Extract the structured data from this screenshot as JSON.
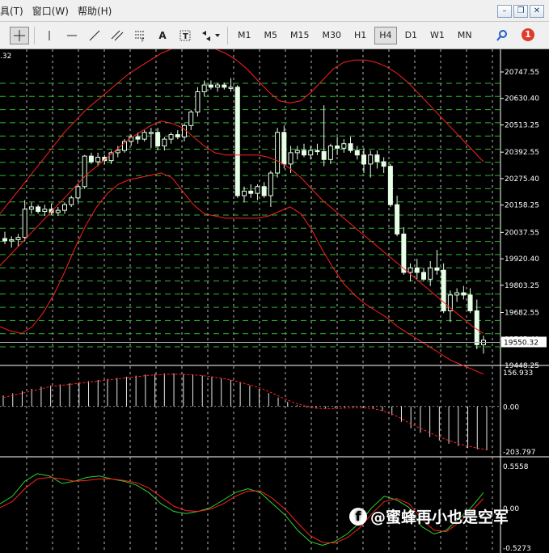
{
  "menu": {
    "items": [
      "具(T)",
      "窗口(W)",
      "帮助(H)"
    ]
  },
  "toolbar": {
    "tools": [
      "crosshair-icon",
      "vertical-line-icon",
      "horizontal-line-icon",
      "trend-line-icon",
      "channel-icon",
      "fibonacci-icon",
      "text-label-icon",
      "text-box-icon",
      "arrows-icon"
    ],
    "text_tool": "A",
    "timeframes": [
      "M1",
      "M5",
      "M15",
      "M30",
      "H1",
      "H4",
      "D1",
      "W1",
      "MN"
    ],
    "active_timeframe": "H4",
    "notification_count": "1"
  },
  "main_chart": {
    "top_left_label": ".32",
    "price_levels": [
      "20747.55",
      "20630.40",
      "20513.25",
      "20392.55",
      "20275.40",
      "20158.25",
      "20037.55",
      "19920.40",
      "19803.25",
      "19682.55",
      "19565.40",
      "19448.25"
    ],
    "current_price": "19550.32",
    "colors": {
      "background": "#000000",
      "grid": "#b8b8b8",
      "candle": "#e6ffe6",
      "bollinger": "#ff2020",
      "level_lines": "#2fb52f"
    }
  },
  "macd_panel": {
    "max_label": "156.933",
    "zero_label": "0.00",
    "min_label": "-203.797"
  },
  "stoch_panel": {
    "max_label": "0.5558",
    "zero_label": "0.00",
    "min_label": "-0.5273"
  },
  "chart_data": {
    "type": "candlestick",
    "price_range": [
      19448.25,
      20747.55
    ],
    "ohlc": [
      [
        20010,
        20040,
        19985,
        20000
      ],
      [
        20000,
        20020,
        19970,
        20005
      ],
      [
        20005,
        20030,
        19975,
        20015
      ],
      [
        20015,
        20180,
        20000,
        20140
      ],
      [
        20140,
        20170,
        20120,
        20150
      ],
      [
        20150,
        20160,
        20120,
        20130
      ],
      [
        20130,
        20160,
        20110,
        20140
      ],
      [
        20140,
        20165,
        20115,
        20125
      ],
      [
        20125,
        20150,
        20110,
        20135
      ],
      [
        20135,
        20170,
        20120,
        20160
      ],
      [
        20160,
        20200,
        20150,
        20190
      ],
      [
        20190,
        20250,
        20170,
        20240
      ],
      [
        20240,
        20380,
        20230,
        20375
      ],
      [
        20375,
        20390,
        20340,
        20350
      ],
      [
        20350,
        20390,
        20330,
        20370
      ],
      [
        20370,
        20380,
        20340,
        20355
      ],
      [
        20355,
        20400,
        20340,
        20390
      ],
      [
        20390,
        20420,
        20370,
        20400
      ],
      [
        20400,
        20450,
        20390,
        20440
      ],
      [
        20440,
        20470,
        20420,
        20460
      ],
      [
        20460,
        20480,
        20430,
        20450
      ],
      [
        20450,
        20490,
        20440,
        20480
      ],
      [
        20480,
        20500,
        20410,
        20480
      ],
      [
        20480,
        20500,
        20400,
        20420
      ],
      [
        20420,
        20460,
        20400,
        20450
      ],
      [
        20450,
        20480,
        20430,
        20470
      ],
      [
        20470,
        20490,
        20450,
        20460
      ],
      [
        20460,
        20520,
        20440,
        20510
      ],
      [
        20510,
        20580,
        20490,
        20570
      ],
      [
        20570,
        20680,
        20550,
        20660
      ],
      [
        20660,
        20710,
        20640,
        20690
      ],
      [
        20690,
        20710,
        20670,
        20680
      ],
      [
        20680,
        20700,
        20660,
        20690
      ],
      [
        20690,
        20700,
        20670,
        20680
      ],
      [
        20680,
        20720,
        20660,
        20680
      ],
      [
        20680,
        20690,
        20190,
        20200
      ],
      [
        20200,
        20240,
        20170,
        20220
      ],
      [
        20220,
        20250,
        20190,
        20210
      ],
      [
        20210,
        20250,
        20180,
        20240
      ],
      [
        20240,
        20260,
        20190,
        20200
      ],
      [
        20200,
        20310,
        20150,
        20300
      ],
      [
        20300,
        20500,
        20280,
        20480
      ],
      [
        20480,
        20510,
        20320,
        20340
      ],
      [
        20340,
        20420,
        20300,
        20390
      ],
      [
        20390,
        20420,
        20360,
        20400
      ],
      [
        20400,
        20430,
        20370,
        20380
      ],
      [
        20380,
        20420,
        20360,
        20400
      ],
      [
        20400,
        20430,
        20380,
        20395
      ],
      [
        20395,
        20600,
        20330,
        20360
      ],
      [
        20360,
        20430,
        20340,
        20420
      ],
      [
        20420,
        20460,
        20380,
        20410
      ],
      [
        20410,
        20450,
        20390,
        20430
      ],
      [
        20430,
        20460,
        20390,
        20400
      ],
      [
        20400,
        20420,
        20360,
        20380
      ],
      [
        20380,
        20410,
        20300,
        20340
      ],
      [
        20340,
        20400,
        20280,
        20380
      ],
      [
        20380,
        20400,
        20320,
        20350
      ],
      [
        20350,
        20370,
        20300,
        20330
      ],
      [
        20330,
        20340,
        20150,
        20160
      ],
      [
        20160,
        20200,
        20020,
        20030
      ],
      [
        20030,
        20060,
        19850,
        19860
      ],
      [
        19860,
        19900,
        19820,
        19880
      ],
      [
        19880,
        19920,
        19830,
        19860
      ],
      [
        19860,
        19880,
        19820,
        19830
      ],
      [
        19830,
        19910,
        19800,
        19880
      ],
      [
        19880,
        19960,
        19850,
        19870
      ],
      [
        19870,
        19900,
        19680,
        19690
      ],
      [
        19690,
        19780,
        19640,
        19760
      ],
      [
        19760,
        19790,
        19730,
        19770
      ],
      [
        19770,
        19800,
        19740,
        19760
      ],
      [
        19760,
        19790,
        19680,
        19690
      ],
      [
        19690,
        19740,
        19520,
        19540
      ],
      [
        19540,
        19580,
        19500,
        19560
      ]
    ],
    "bollinger_upper": [
      20120,
      20180,
      20240,
      20300,
      20360,
      20420,
      20480,
      20530,
      20580,
      20620,
      20660,
      20700,
      20740,
      20770,
      20800,
      20830,
      20850,
      20860,
      20865,
      20860,
      20850,
      20830,
      20800,
      20760,
      20710,
      20660,
      20620,
      20610,
      20620,
      20660,
      20710,
      20760,
      20790,
      20800,
      20800,
      20790,
      20770,
      20740,
      20700,
      20650,
      20600,
      20550,
      20500,
      20450,
      20400,
      20350
    ],
    "bollinger_mid": [
      19890,
      19940,
      19990,
      20040,
      20090,
      20140,
      20190,
      20240,
      20290,
      20330,
      20370,
      20410,
      20450,
      20480,
      20510,
      20530,
      20520,
      20500,
      20460,
      20420,
      20390,
      20380,
      20380,
      20380,
      20380,
      20370,
      20350,
      20320,
      20280,
      20230,
      20180,
      20140,
      20100,
      20060,
      20020,
      19980,
      19940,
      19900,
      19860,
      19820,
      19780,
      19740,
      19700,
      19660,
      19620,
      19590
    ],
    "bollinger_lower": [
      19620,
      19600,
      19590,
      19620,
      19680,
      19760,
      19860,
      19970,
      20070,
      20150,
      20210,
      20250,
      20270,
      20280,
      20290,
      20300,
      20280,
      20220,
      20160,
      20120,
      20110,
      20100,
      20100,
      20100,
      20100,
      20110,
      20130,
      20150,
      20120,
      20050,
      19960,
      19880,
      19810,
      19760,
      19720,
      19690,
      19660,
      19620,
      19590,
      19560,
      19530,
      19500,
      19470,
      19450,
      19430,
      19410
    ],
    "macd_hist": [
      50,
      60,
      70,
      80,
      90,
      95,
      100,
      105,
      110,
      115,
      120,
      125,
      130,
      135,
      140,
      145,
      148,
      150,
      150,
      148,
      145,
      140,
      135,
      128,
      120,
      108,
      95,
      80,
      60,
      40,
      20,
      5,
      -5,
      -10,
      -10,
      -8,
      -5,
      -3,
      -5,
      -10,
      -20,
      -40,
      -70,
      -100,
      -120,
      -140,
      -155,
      -170,
      -180,
      -190,
      -195,
      -200
    ],
    "macd_signal": [
      40,
      50,
      60,
      70,
      80,
      90,
      95,
      100,
      105,
      110,
      115,
      120,
      125,
      130,
      135,
      140,
      143,
      145,
      147,
      146,
      144,
      140,
      135,
      128,
      120,
      110,
      98,
      85,
      68,
      48,
      28,
      12,
      0,
      -8,
      -10,
      -10,
      -8,
      -6,
      -6,
      -10,
      -20,
      -35,
      -55,
      -80,
      -100,
      -120,
      -140,
      -155,
      -170,
      -180,
      -190,
      -198
    ],
    "stoch_main": [
      0.05,
      0.15,
      0.35,
      0.45,
      0.42,
      0.32,
      0.35,
      0.4,
      0.42,
      0.38,
      0.35,
      0.3,
      0.2,
      0.05,
      -0.05,
      -0.08,
      -0.05,
      0.0,
      0.1,
      0.2,
      0.25,
      0.2,
      0.05,
      -0.1,
      -0.3,
      -0.45,
      -0.5,
      -0.45,
      -0.35,
      -0.2,
      0.0,
      0.15,
      0.1,
      0.0,
      -0.25,
      -0.35,
      -0.3,
      -0.15,
      0.0,
      0.2
    ],
    "stoch_signal": [
      0.0,
      0.08,
      0.25,
      0.38,
      0.4,
      0.38,
      0.35,
      0.36,
      0.38,
      0.38,
      0.36,
      0.33,
      0.26,
      0.14,
      0.02,
      -0.04,
      -0.05,
      -0.02,
      0.05,
      0.15,
      0.22,
      0.22,
      0.12,
      -0.02,
      -0.2,
      -0.37,
      -0.46,
      -0.47,
      -0.4,
      -0.27,
      -0.08,
      0.08,
      0.12,
      0.05,
      -0.15,
      -0.3,
      -0.32,
      -0.2,
      -0.05,
      0.12
    ]
  },
  "watermark": {
    "logo": "f",
    "text": "@蜜蜂再小也是空军"
  }
}
